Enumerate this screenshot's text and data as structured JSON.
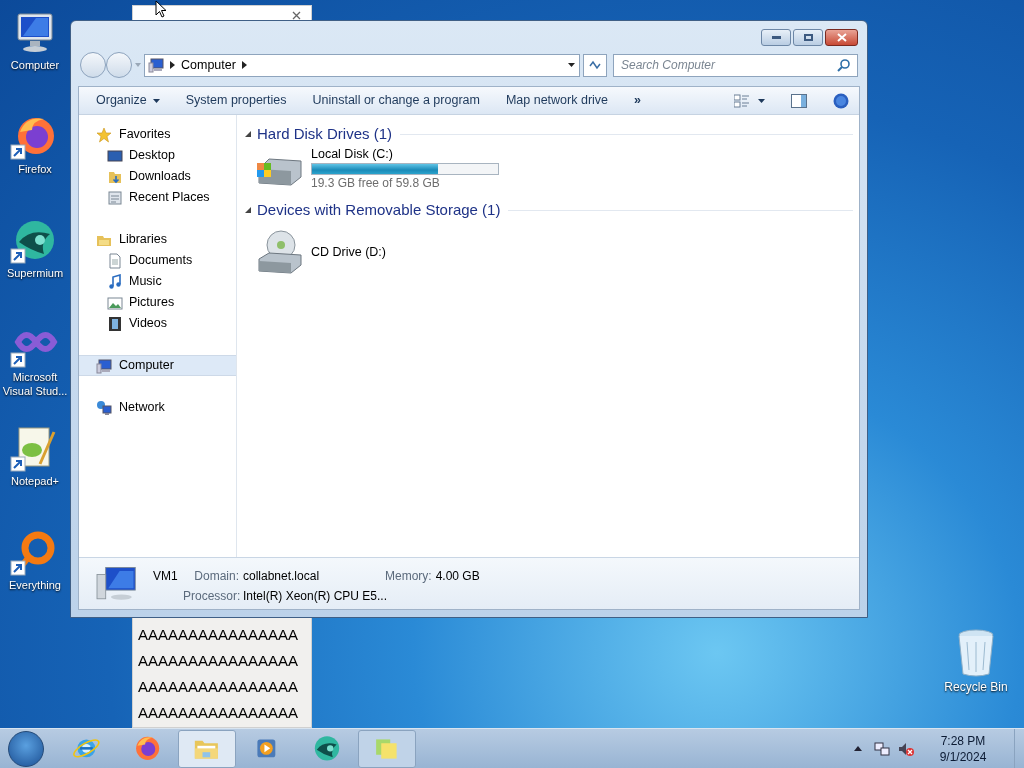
{
  "desktop_icons": [
    {
      "label": "Computer",
      "kind": "computer"
    },
    {
      "label": "Firefox",
      "kind": "firefox"
    },
    {
      "label": "Supermium",
      "kind": "supermium"
    },
    {
      "label": "Microsoft Visual Stud...",
      "kind": "vs"
    },
    {
      "label": "Notepad+",
      "kind": "notepad"
    },
    {
      "label": "Everything",
      "kind": "everything"
    }
  ],
  "recycle_bin": {
    "label": "Recycle Bin"
  },
  "background_window": {
    "lines": [
      "AAAAAAAAAAAAAAAA",
      "AAAAAAAAAAAAAAAA",
      "AAAAAAAAAAAAAAAA",
      "AAAAAAAAAAAAAAAA"
    ]
  },
  "explorer": {
    "address": {
      "crumbs": [
        "Computer"
      ]
    },
    "search": {
      "placeholder": "Search Computer"
    },
    "toolbar": [
      {
        "label": "Organize",
        "kind": "menu"
      },
      {
        "label": "System properties",
        "kind": "button"
      },
      {
        "label": "Uninstall or change a program",
        "kind": "button"
      },
      {
        "label": "Map network drive",
        "kind": "button"
      },
      {
        "label": "»",
        "kind": "more"
      }
    ],
    "nav": [
      {
        "label": "Favorites",
        "kind": "star",
        "selected": false,
        "children": [
          {
            "label": "Desktop",
            "kind": "desktop",
            "selected": false
          },
          {
            "label": "Downloads",
            "kind": "downloads",
            "selected": false
          },
          {
            "label": "Recent Places",
            "kind": "recent",
            "selected": false
          }
        ]
      },
      {
        "label": "Libraries",
        "kind": "library",
        "selected": false,
        "children": [
          {
            "label": "Documents",
            "kind": "document",
            "selected": false
          },
          {
            "label": "Music",
            "kind": "music",
            "selected": false
          },
          {
            "label": "Pictures",
            "kind": "picture",
            "selected": false
          },
          {
            "label": "Videos",
            "kind": "video",
            "selected": false
          }
        ]
      },
      {
        "label": "Computer",
        "kind": "computer",
        "selected": true
      },
      {
        "label": "Network",
        "kind": "network",
        "selected": false
      }
    ],
    "groups": [
      {
        "title": "Hard Disk Drives (1)",
        "items": [
          {
            "name": "Local Disk (C:)",
            "kind": "disk",
            "level": 0.68,
            "free": "19.3 GB free of 59.8 GB"
          }
        ]
      },
      {
        "title": "Devices with Removable Storage (1)",
        "items": [
          {
            "name": "CD Drive (D:)",
            "kind": "cd"
          }
        ]
      }
    ],
    "details": {
      "name": "VM1",
      "rows": [
        [
          {
            "label": "Domain:",
            "value": "collabnet.local"
          },
          {
            "label": "Memory:",
            "value": "4.00 GB"
          }
        ],
        [
          {
            "label": "Processor:",
            "value": "Intel(R) Xeon(R) CPU E5..."
          }
        ]
      ]
    }
  },
  "taskbar": {
    "apps": [
      {
        "kind": "ie",
        "running": false,
        "selected": false
      },
      {
        "kind": "firefox",
        "running": false,
        "selected": false
      },
      {
        "kind": "folder",
        "running": true,
        "selected": true
      },
      {
        "kind": "media",
        "running": false,
        "selected": false
      },
      {
        "kind": "supermium",
        "running": false,
        "selected": false
      },
      {
        "kind": "notes",
        "running": true,
        "selected": false
      }
    ],
    "clock": {
      "time": "7:28 PM",
      "date": "9/1/2024"
    }
  }
}
